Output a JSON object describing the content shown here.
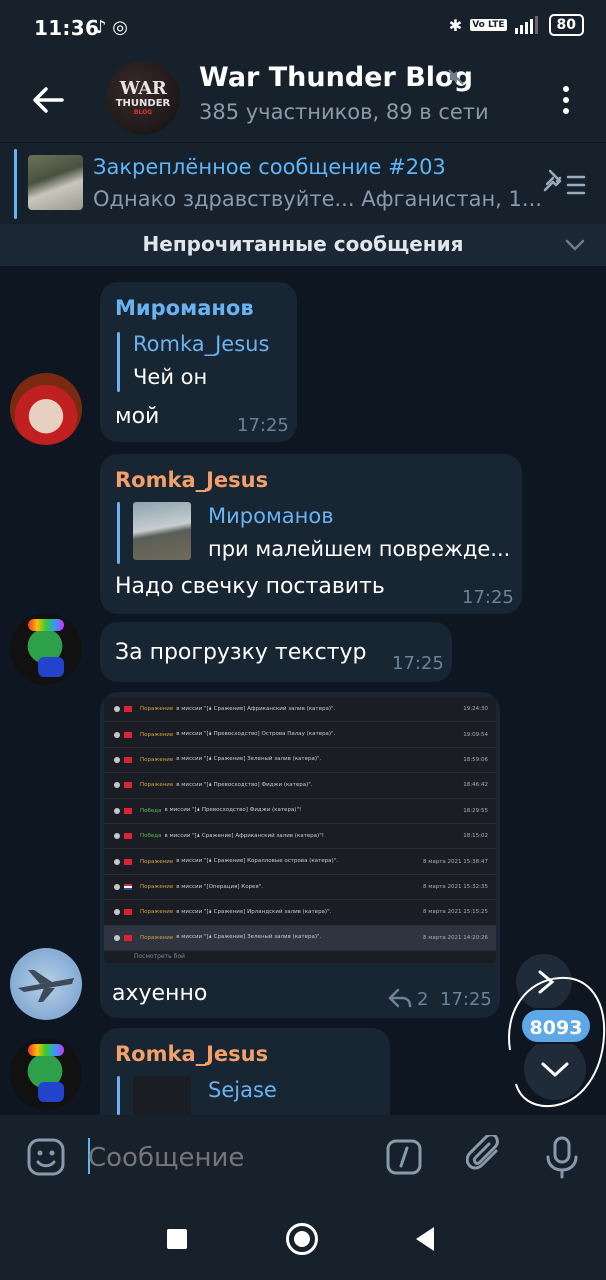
{
  "status_bar": {
    "time": "11:36",
    "battery": "80",
    "network": "4G",
    "volte": "Vo LTE"
  },
  "header": {
    "title": "War Thunder Blog",
    "subtitle": "385 участников, 89 в сети",
    "avatar": {
      "line1": "WAR",
      "line2": "THUNDER",
      "line3": "BLOG"
    }
  },
  "pinned": {
    "title": "Закреплённое сообщение #203",
    "text": "Однако здравствуйте...  Афганистан, 1..."
  },
  "unread_banner": {
    "label": "Непрочитанные сообщения"
  },
  "messages": [
    {
      "sender": "Мироманов",
      "reply_to": "Romka_Jesus",
      "reply_text": "Чей он",
      "text": "мой",
      "time": "17:25"
    },
    {
      "sender": "Romka_Jesus",
      "reply_to": "Мироманов",
      "reply_text": "при малейшем поврежде...",
      "text": "Надо свечку поставить",
      "time": "17:25"
    },
    {
      "text": "За прогрузку текстур",
      "time": "17:25"
    },
    {
      "text": "ахуенно",
      "time": "17:25",
      "replies": "2",
      "log_rows": [
        {
          "status": "Поражение",
          "win": false,
          "msg": "в миссии \"[🌢 Сражение] Африканский залив (катера)\".",
          "date": "19:24:30",
          "flag": "ru"
        },
        {
          "status": "Поражение",
          "win": false,
          "msg": "в миссии \"[🌢 Превосходство] Острова Палау (катера)\".",
          "date": "19:09:54",
          "flag": "ru"
        },
        {
          "status": "Поражение",
          "win": false,
          "msg": "в миссии \"[🌢 Сражение] Зеленый залив (катера)\".",
          "date": "18:59:06",
          "flag": "ru"
        },
        {
          "status": "Поражение",
          "win": false,
          "msg": "в миссии \"[🌢 Превосходство] Фиджи (катера)\".",
          "date": "18:46:42",
          "flag": "ru"
        },
        {
          "status": "Победа",
          "win": true,
          "msg": "в миссии \"[🌢 Превосходство] Фиджи (катера)\"!",
          "date": "18:29:55",
          "flag": "ru"
        },
        {
          "status": "Победа",
          "win": true,
          "msg": "в миссии \"[🌢 Сражение] Африканский залив (катера)\"!",
          "date": "18:15:02",
          "flag": "ru"
        },
        {
          "status": "Поражение",
          "win": false,
          "msg": "в миссии \"[🌢 Сражение] Коралловые острова (катера)\".",
          "date": "8 марта 2021 15:38:47",
          "flag": "ru"
        },
        {
          "status": "Поражение",
          "win": false,
          "msg": "в миссии \"[Операция] Корея\".",
          "date": "8 марта 2021 15:32:35",
          "flag": "us"
        },
        {
          "status": "Поражение",
          "win": false,
          "msg": "в миссии \"[🌢 Сражение] Ирландский залив (катера)\".",
          "date": "8 марта 2021 15:15:25",
          "flag": "ru"
        },
        {
          "status": "Поражение",
          "win": false,
          "msg": "в миссии \"[🌢 Сражение] Зеленый залив (катера)\".",
          "date": "8 марта 2021 14:20:26",
          "flag": "ru"
        }
      ],
      "log_footer": "Посмотреть бой"
    },
    {
      "sender": "Romka_Jesus",
      "reply_to": "Sejase"
    }
  ],
  "scroll_badge": "8093",
  "composer": {
    "placeholder": "Сообщение"
  },
  "icons": [
    "back-arrow-icon",
    "mute-icon",
    "more-vert-icon",
    "pin-list-icon",
    "chevron-down-icon",
    "forward-icon",
    "reply-icon",
    "emoji-icon",
    "bot-command-icon",
    "attach-icon",
    "mic-icon"
  ],
  "colors": {
    "background": "#0e1621",
    "panel": "#17212b",
    "bubble": "#182533",
    "accent": "#5eb5f7",
    "orange_name": "#f4a06a",
    "badge": "#5fa8e8"
  }
}
